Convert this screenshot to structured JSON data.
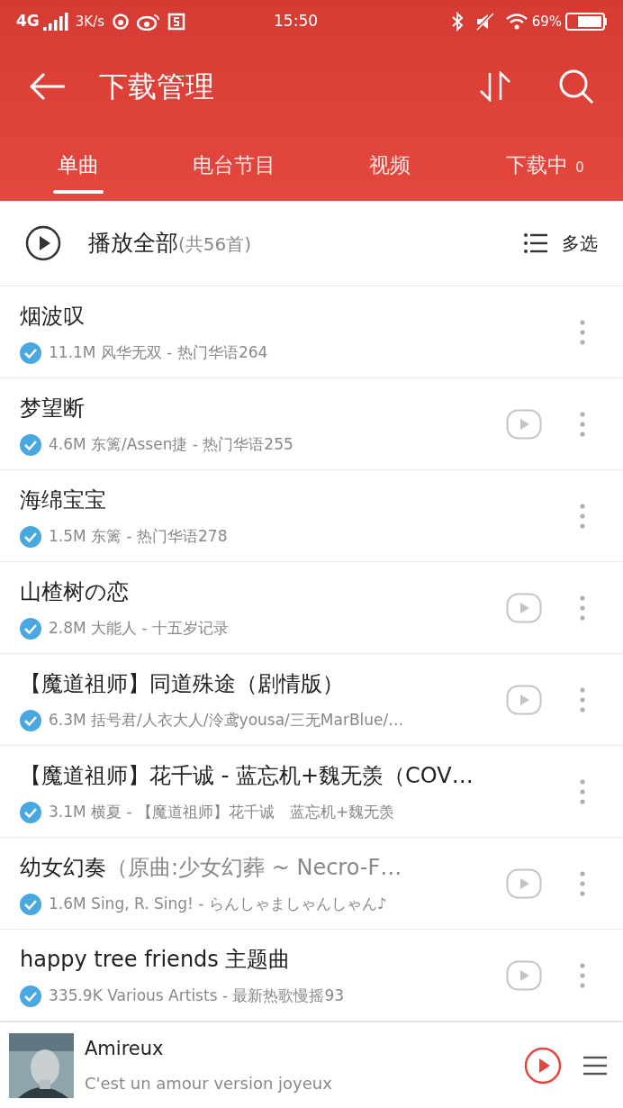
{
  "status_bar": {
    "network": "4G",
    "speed": "3K/s",
    "time": "15:50",
    "battery": "69%"
  },
  "app_bar": {
    "title": "下载管理"
  },
  "tabs": [
    {
      "label": "单曲",
      "selected": true
    },
    {
      "label": "电台节目",
      "selected": false
    },
    {
      "label": "视频",
      "selected": false
    },
    {
      "label": "下载中",
      "badge": "0",
      "selected": false
    }
  ],
  "play_all": {
    "label": "播放全部",
    "count": "(共56首)",
    "multi_select": "多选"
  },
  "songs": [
    {
      "title": "烟波叹",
      "size": "11.1M",
      "info": "风华无双 - 热门华语264",
      "checked": true,
      "video": false
    },
    {
      "title": "梦望断",
      "size": "4.6M",
      "info": "东篱/Assen捷 - 热门华语255",
      "checked": true,
      "video": true
    },
    {
      "title": "海绵宝宝",
      "size": "1.5M",
      "info": "东篱 - 热门华语278",
      "checked": true,
      "video": false
    },
    {
      "title": "山楂树の恋",
      "size": "2.8M",
      "info": "大能人 - 十五岁记录",
      "checked": true,
      "video": true
    },
    {
      "title": "【魔道祖师】同道殊途（剧情版）",
      "size": "6.3M",
      "info": "括号君/人衣大人/泠鸢yousa/三无MarBlue/…",
      "checked": true,
      "video": true
    },
    {
      "title": "【魔道祖师】花千诚 - 蓝忘机+魏无羡（COV…",
      "size": "3.1M",
      "info": "横夏 - 【魔道祖师】花千诚　蓝忘机+魏无羡",
      "checked": true,
      "video": false
    },
    {
      "title": "幼女幻奏",
      "title_note": "（原曲:少女幻葬 ~ Necro-F…",
      "size": "1.6M",
      "info": "Sing, R. Sing! - らんしゃましゃんしゃん♪",
      "checked": true,
      "video": true
    },
    {
      "title": "happy tree friends 主题曲",
      "size": "335.9K",
      "info": "Various Artists - 最新热歌慢摇93",
      "checked": true,
      "video": true
    }
  ],
  "player": {
    "title": "Amireux",
    "subtitle": "C'est un amour version joyeux"
  }
}
